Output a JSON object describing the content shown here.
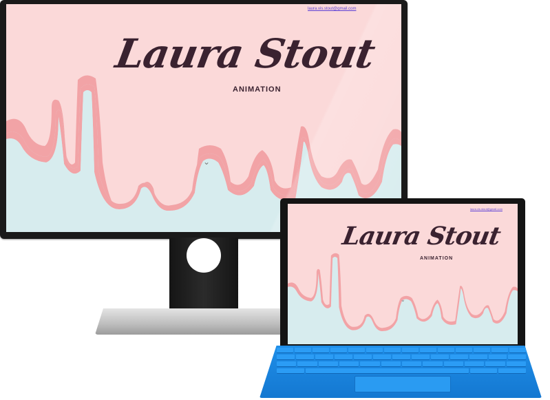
{
  "site": {
    "email": "laura.vis.stout@gmail.com",
    "title": "Laura Stout",
    "subtitle": "ANIMATION",
    "scroll_indicator": "⌄"
  },
  "devices": [
    "desktop-monitor",
    "tablet-with-keyboard"
  ],
  "colors": {
    "background_pink": "#fbd9d9",
    "drip_shade": "#f2a3a6",
    "sky_blue": "#d7ecee",
    "title_ink": "#3a2230",
    "link": "#5b3fd6",
    "keyboard_blue": "#1a84de"
  },
  "icons": {
    "scroll_down": "chevron-down-icon"
  }
}
